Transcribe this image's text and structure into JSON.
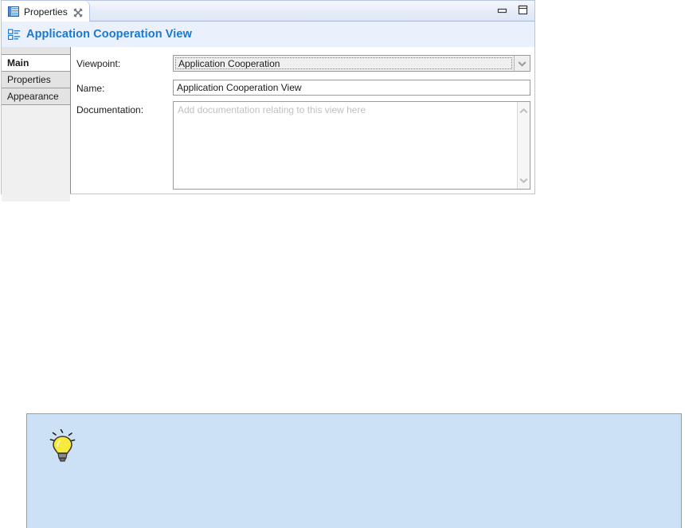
{
  "window": {
    "tab_label": "Properties",
    "tab_icon": "properties-table-icon",
    "close_icon": "close-icon",
    "minimize_icon": "minimize-icon",
    "maximize_icon": "maximize-icon"
  },
  "header": {
    "icon": "view-list-icon",
    "title": "Application Cooperation View",
    "title_color": "#1878d2",
    "band_color": "#eaf1fc"
  },
  "side_tabs": [
    {
      "label": "Main",
      "selected": true
    },
    {
      "label": "Properties",
      "selected": false
    },
    {
      "label": "Appearance",
      "selected": false
    }
  ],
  "form": {
    "viewpoint": {
      "label": "Viewpoint:",
      "value": "Application Cooperation",
      "dropdown_icon": "chevron-down-icon"
    },
    "name": {
      "label": "Name:",
      "value": "Application Cooperation View"
    },
    "documentation": {
      "label": "Documentation:",
      "value": "",
      "placeholder": "Add documentation relating to this view here",
      "scroll_up_icon": "chevron-up-icon",
      "scroll_down_icon": "chevron-down-icon"
    }
  },
  "tip": {
    "icon": "lightbulb-icon",
    "text": "",
    "background_color": "#cde1f6",
    "border_color": "#9e9e9e"
  }
}
